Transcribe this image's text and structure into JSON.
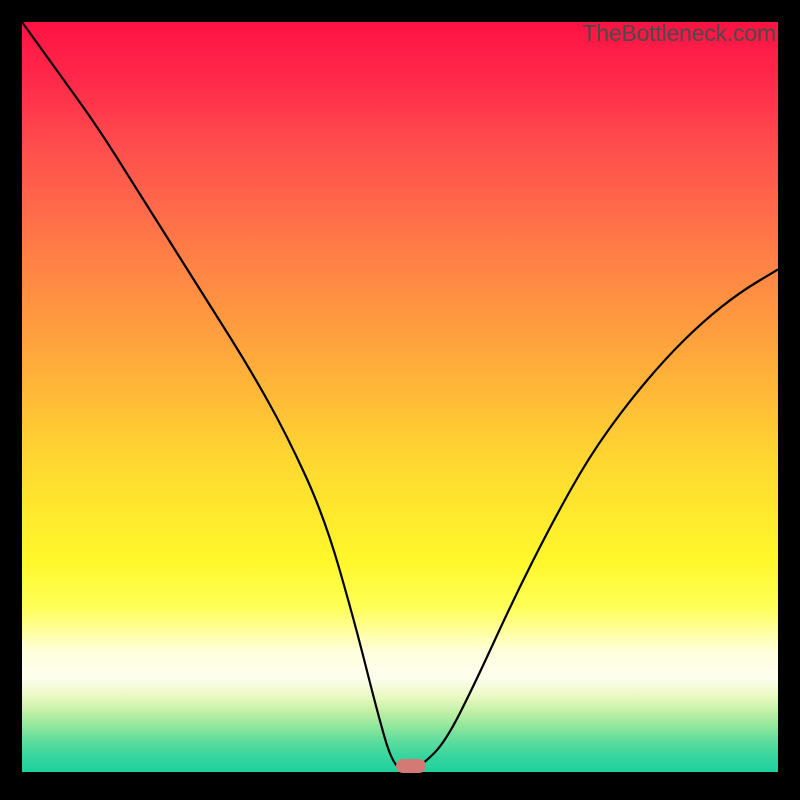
{
  "watermark": "TheBottleneck.com",
  "chart_data": {
    "type": "line",
    "title": "",
    "xlabel": "",
    "ylabel": "",
    "xlim": [
      0,
      100
    ],
    "ylim": [
      0,
      100
    ],
    "series": [
      {
        "name": "bottleneck-curve",
        "x": [
          0,
          5,
          10,
          15,
          20,
          25,
          30,
          35,
          40,
          44,
          47,
          49,
          51,
          53,
          56,
          60,
          65,
          70,
          75,
          80,
          85,
          90,
          95,
          100
        ],
        "values": [
          100,
          93,
          86,
          78,
          70,
          62,
          54,
          45,
          34,
          20,
          8,
          1,
          0,
          1,
          4,
          12,
          23,
          33,
          42,
          49,
          55,
          60,
          64,
          67
        ]
      }
    ],
    "marker": {
      "x": 51.5,
      "y": 0.8
    },
    "gradient_stops": [
      {
        "pct": 0,
        "color": "#ff1244"
      },
      {
        "pct": 50,
        "color": "#ffbb37"
      },
      {
        "pct": 80,
        "color": "#ffff57"
      },
      {
        "pct": 100,
        "color": "#1fd19e"
      }
    ]
  }
}
